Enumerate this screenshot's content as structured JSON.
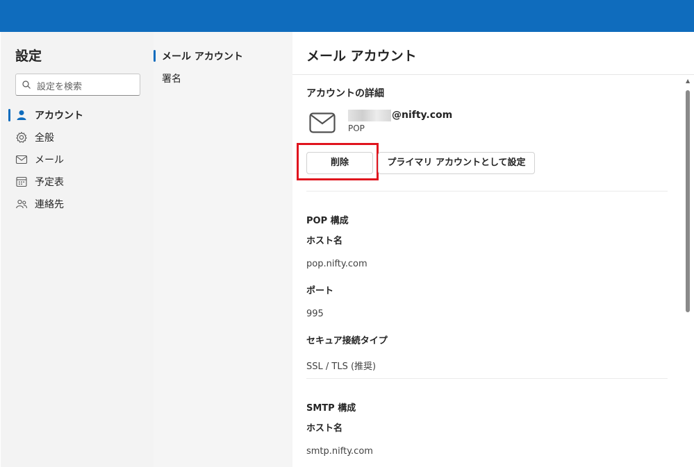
{
  "settings": {
    "title": "設定",
    "search_placeholder": "設定を検索",
    "nav": [
      {
        "label": "アカウント",
        "icon": "person-icon",
        "active": true
      },
      {
        "label": "全般",
        "icon": "gear-icon"
      },
      {
        "label": "メール",
        "icon": "mail-icon"
      },
      {
        "label": "予定表",
        "icon": "calendar-icon"
      },
      {
        "label": "連絡先",
        "icon": "people-icon"
      }
    ]
  },
  "subnav": {
    "items": [
      {
        "label": "メール アカウント",
        "active": true
      },
      {
        "label": "署名"
      }
    ]
  },
  "content": {
    "title": "メール アカウント",
    "details_title": "アカウントの詳細",
    "email": "@nifty.com",
    "account_type": "POP",
    "delete_button": "削除",
    "primary_button": "プライマリ アカウントとして設定",
    "pop": {
      "title": "POP 構成",
      "host_label": "ホスト名",
      "host_value": "pop.nifty.com",
      "port_label": "ポート",
      "port_value": "995",
      "security_label": "セキュア接続タイプ",
      "security_value": "SSL / TLS (推奨)"
    },
    "smtp": {
      "title": "SMTP 構成",
      "host_label": "ホスト名",
      "host_value": "smtp.nifty.com"
    }
  },
  "colors": {
    "accent": "#0f6cbd",
    "highlight": "#e0141e"
  }
}
